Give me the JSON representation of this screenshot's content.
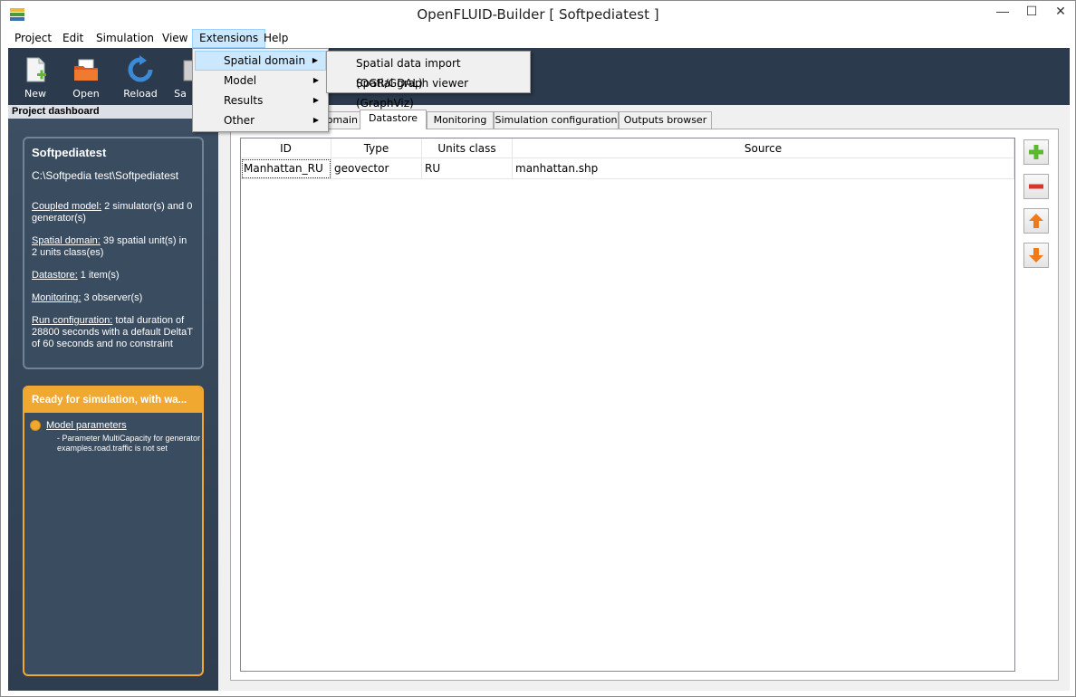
{
  "window": {
    "title": "OpenFLUID-Builder [ Softpediatest ]",
    "controls": {
      "minimize": "—",
      "maximize": "☐",
      "close": "✕"
    }
  },
  "menubar": {
    "items": [
      {
        "label": "Project"
      },
      {
        "label": "Edit"
      },
      {
        "label": "Simulation"
      },
      {
        "label": "View"
      },
      {
        "label": "Extensions"
      },
      {
        "label": "Help"
      }
    ],
    "active": "Extensions"
  },
  "extensions_menu": {
    "items": [
      {
        "label": "Spatial domain",
        "has_submenu": true
      },
      {
        "label": "Model",
        "has_submenu": true
      },
      {
        "label": "Results",
        "has_submenu": true
      },
      {
        "label": "Other",
        "has_submenu": true
      }
    ],
    "highlighted": "Spatial domain"
  },
  "spatial_domain_submenu": {
    "items": [
      {
        "label": "Spatial data import (OGR/GDAL)"
      },
      {
        "label": "Spatial graph viewer (GraphViz)"
      }
    ]
  },
  "toolbar": {
    "buttons": [
      {
        "label": "New",
        "icon": "new-document-icon"
      },
      {
        "label": "Open",
        "icon": "open-folder-icon"
      },
      {
        "label": "Reload",
        "icon": "reload-icon"
      },
      {
        "label": "Sa",
        "icon": "save-icon"
      }
    ]
  },
  "dashboard": {
    "header": "Project dashboard",
    "project_name": "Softpediatest",
    "project_path": "C:\\Softpedia test\\Softpediatest",
    "coupled_model_label": "Coupled model:",
    "coupled_model_text": " 2 simulator(s) and 0 generator(s)",
    "spatial_domain_label": "Spatial domain:",
    "spatial_domain_text": " 39 spatial unit(s) in 2 units class(es)",
    "datastore_label": "Datastore:",
    "datastore_text": " 1 item(s)",
    "monitoring_label": "Monitoring:",
    "monitoring_text": " 3 observer(s)",
    "run_config_label": "Run configuration:",
    "run_config_text": " total duration of 28800 seconds with a default DeltaT of 60 seconds and no constraint",
    "status_header": "Ready for simulation, with wa...",
    "status_item_title": "Model parameters",
    "status_item_detail": "- Parameter MultiCapacity for generator examples.road.traffic is not set"
  },
  "tabs": {
    "items": [
      {
        "label": "omain"
      },
      {
        "label": "Datastore"
      },
      {
        "label": "Monitoring"
      },
      {
        "label": "Simulation configuration"
      },
      {
        "label": "Outputs browser"
      }
    ],
    "active": "Datastore"
  },
  "datastore_table": {
    "columns": [
      "ID",
      "Type",
      "Units class",
      "Source"
    ],
    "rows": [
      [
        "Manhattan_RU",
        "geovector",
        "RU",
        "manhattan.shp"
      ]
    ]
  },
  "side_buttons": [
    {
      "icon": "add-icon",
      "color": "#5cb82e"
    },
    {
      "icon": "remove-icon",
      "color": "#d9362b"
    },
    {
      "icon": "move-up-icon",
      "color": "#f07a1a"
    },
    {
      "icon": "move-down-icon",
      "color": "#f07a1a"
    }
  ],
  "colors": {
    "toolbar_bg": "#2b3a4c",
    "dashboard_bg": "#3a4c60",
    "status_accent": "#f0a830",
    "menu_highlight": "#cce8ff"
  }
}
